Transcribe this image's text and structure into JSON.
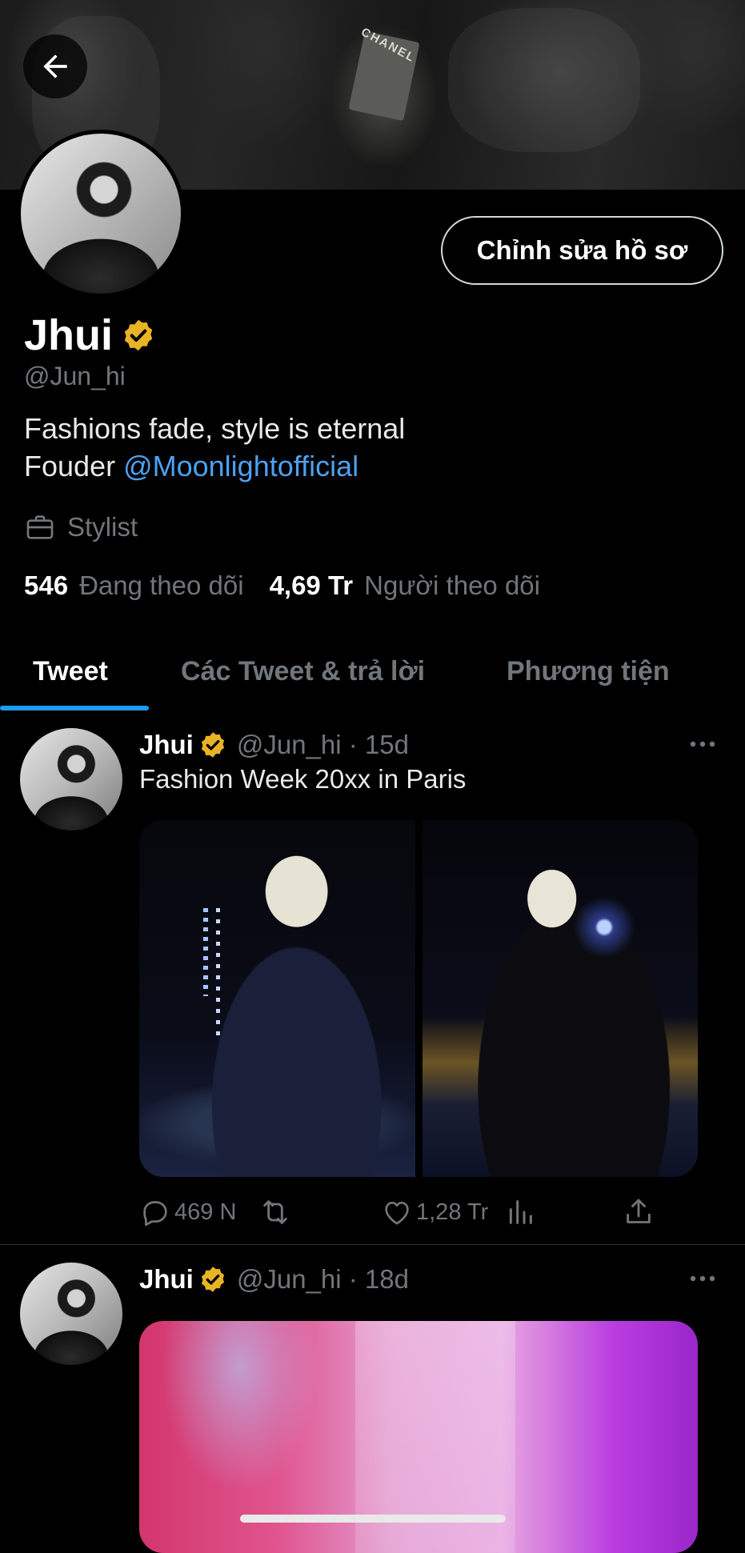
{
  "profile": {
    "name": "Jhui",
    "handle": "@Jun_hi",
    "bio_line1": "Fashions fade, style is eternal",
    "bio_line2_prefix": "Fouder ",
    "bio_mention": "@Moonlightofficial",
    "job": "Stylist",
    "following_count": "546",
    "following_label": "Đang theo dõi",
    "followers_count": "4,69 Tr",
    "followers_label": "Người theo dõi",
    "edit_button": "Chỉnh sửa hồ sơ",
    "banner_label": "CHANEL"
  },
  "tabs": [
    {
      "label": "Tweet",
      "active": true
    },
    {
      "label": "Các Tweet & trả lời",
      "active": false
    },
    {
      "label": "Phương tiện",
      "active": false
    }
  ],
  "tweets": [
    {
      "name": "Jhui",
      "meta": "@Jun_hi · 15d",
      "text": "Fashion Week 20xx in Paris",
      "replies": "469 N",
      "likes": "1,28 Tr"
    },
    {
      "name": "Jhui",
      "meta": "@Jun_hi · 18d"
    }
  ],
  "colors": {
    "background": "#000000",
    "accent": "#1d9bf0",
    "mention": "#4da1f0",
    "verified": "#e8b325",
    "muted": "#71767b"
  },
  "icons": [
    "back-arrow-icon",
    "verified-badge-icon",
    "briefcase-icon",
    "more-icon",
    "reply-icon",
    "retweet-icon",
    "like-icon",
    "analytics-icon",
    "share-icon"
  ]
}
